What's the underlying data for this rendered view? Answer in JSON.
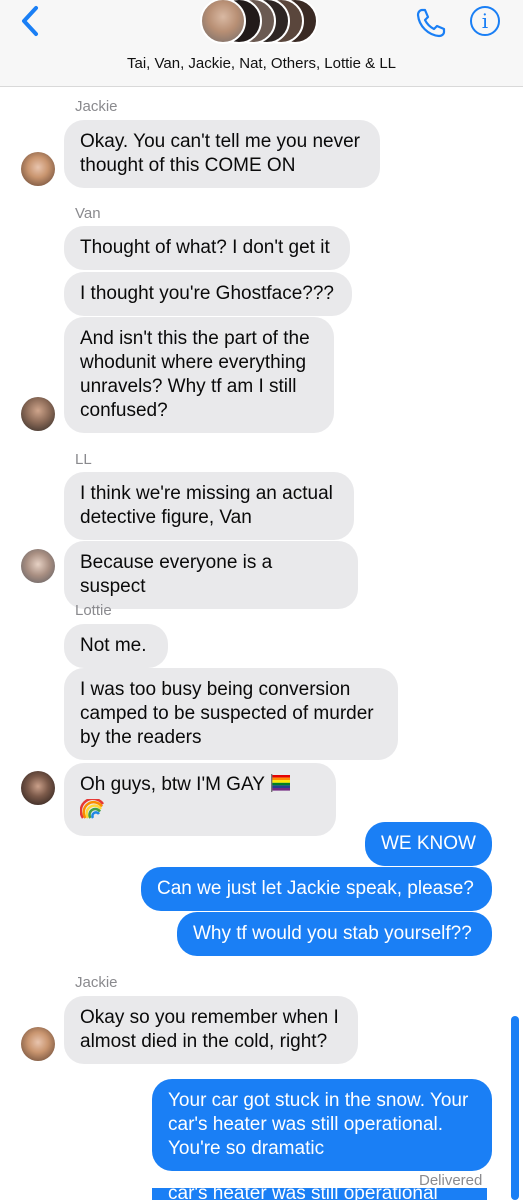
{
  "header": {
    "group_names": "Tai, Van, Jackie, Nat, Others, Lottie & LL",
    "back_icon": "chevron-left-icon",
    "call_icon": "phone-icon",
    "info_icon": "info-icon",
    "info_glyph": "i",
    "accent": "#1a7ff5"
  },
  "messages": [
    {
      "sender": "Jackie",
      "text": "Okay. You can't tell me you never thought of this COME ON"
    },
    {
      "sender": "Van",
      "text": "Thought of what? I don't get it"
    },
    {
      "text": "I thought you're Ghostface???"
    },
    {
      "text": "And isn't this the part of the whodunit where everything unravels? Why tf am I still confused?"
    },
    {
      "sender": "LL",
      "text": "I think we're missing an actual detective figure, Van"
    },
    {
      "text": "Because everyone is a suspect"
    },
    {
      "sender": "Lottie",
      "text": "Not me."
    },
    {
      "text": "I was too busy being conversion camped to be suspected of murder by the readers"
    },
    {
      "text": "Oh guys, btw I'M GAY"
    },
    {
      "text": "WE KNOW"
    },
    {
      "text": "Can we just let Jackie speak, please?"
    },
    {
      "text": "Why tf would you stab yourself??"
    },
    {
      "sender": "Jackie",
      "text": "Okay so you remember when I almost died in the cold, right?"
    },
    {
      "text": "Your car got stuck in the snow. Your car's heater was still operational. You're so dramatic"
    },
    {
      "text": "car's heater was still operational"
    }
  ],
  "status": {
    "delivered": "Delivered"
  },
  "colors": {
    "incoming_bubble": "#e9e9eb",
    "outgoing_bubble": "#1a7ff5"
  }
}
